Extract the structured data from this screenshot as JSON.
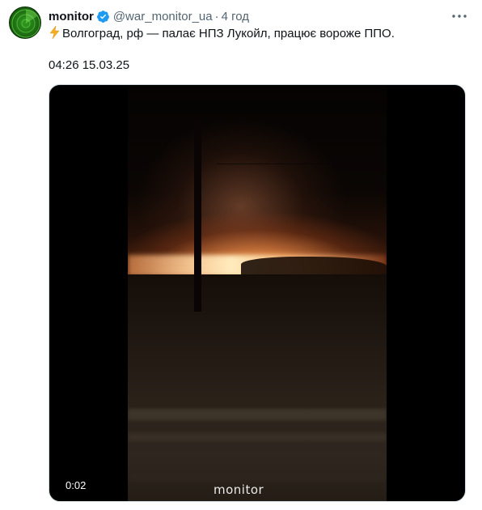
{
  "tweet": {
    "author_name": "monitor",
    "handle": "@war_monitor_ua",
    "separator": "·",
    "time_ago": "4 год",
    "text": "Волгоград, рф — палає НПЗ Лукойл, працює вороже ППО.",
    "timestamp_text": "04:26 15.03.25"
  },
  "media": {
    "duration": "0:02",
    "watermark": "monitor"
  },
  "colors": {
    "verified_badge": "#1d9bf0",
    "text_primary": "#0f1419",
    "text_secondary": "#536471",
    "avatar_green": "#2f9a1f",
    "bolt": "#f5b022"
  },
  "icons": {
    "verified": "verified-badge-icon",
    "more": "more-options-icon",
    "emoji": "lightning-bolt-icon"
  }
}
